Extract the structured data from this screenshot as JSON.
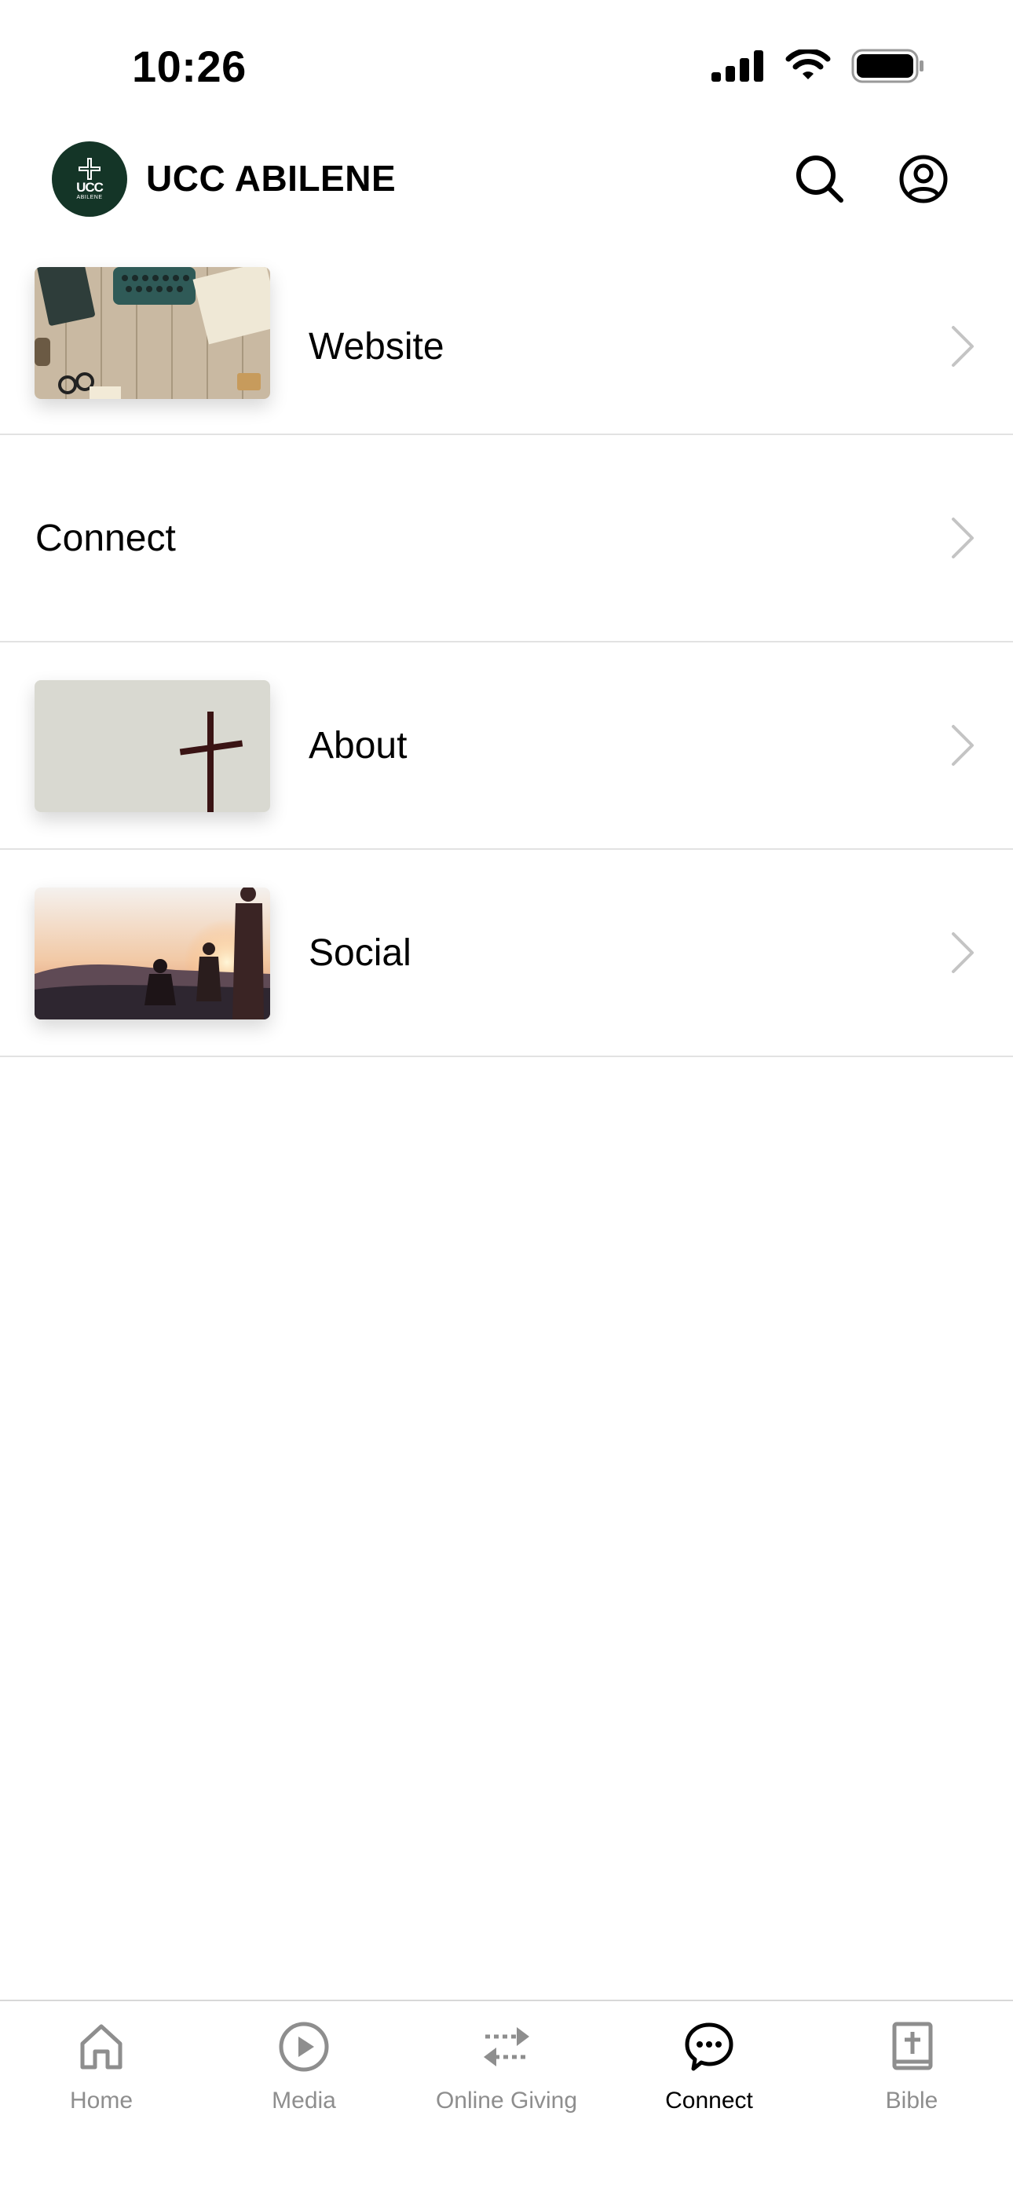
{
  "status_bar": {
    "time": "10:26",
    "icons": [
      "cellular-signal-icon",
      "wifi-icon",
      "battery-icon"
    ]
  },
  "header": {
    "logo": {
      "mark": "UCC",
      "sub": "ABILENE",
      "bg_color": "#143527"
    },
    "title": "UCC ABILENE",
    "actions": [
      "search-icon",
      "profile-icon"
    ]
  },
  "list": {
    "items": [
      {
        "label": "Website",
        "thumbnail": "typewriter-desk-image"
      },
      {
        "label": "Connect",
        "thumbnail": null
      },
      {
        "label": "About",
        "thumbnail": "wooden-cross-image"
      },
      {
        "label": "Social",
        "thumbnail": "sunset-people-image"
      }
    ],
    "chevron_color": "#c4c4c4"
  },
  "tabbar": {
    "active_color": "#000000",
    "inactive_color": "#8e8e8e",
    "tabs": [
      {
        "label": "Home",
        "icon": "home-icon",
        "active": false
      },
      {
        "label": "Media",
        "icon": "play-circle-icon",
        "active": false
      },
      {
        "label": "Online Giving",
        "icon": "transfer-arrows-icon",
        "active": false
      },
      {
        "label": "Connect",
        "icon": "chat-bubble-icon",
        "active": true
      },
      {
        "label": "Bible",
        "icon": "bible-icon",
        "active": false
      }
    ]
  }
}
